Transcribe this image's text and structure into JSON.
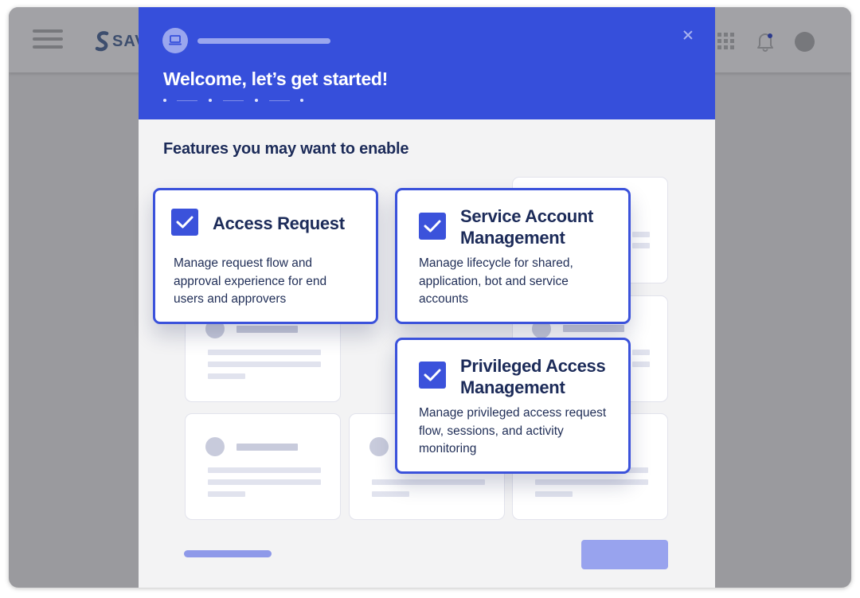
{
  "app": {
    "logo_text": "SAV"
  },
  "colors": {
    "accent": "#364fdb",
    "card_border": "#3b52db",
    "overlay": "#9a9a9e",
    "modal_bg": "#f3f3f4",
    "title_text": "#1c2b59"
  },
  "icons": {
    "menu": "hamburger-icon",
    "apps": "grid-icon",
    "notifications": "bell-icon",
    "profile": "avatar",
    "header": "laptop-icon",
    "close": "close-icon",
    "check": "check-icon"
  },
  "modal": {
    "title": "Welcome, let’s get started!",
    "steps_total": 4,
    "section_title": "Features you may want to enable",
    "features": [
      {
        "title": "Access Request",
        "description": "Manage request flow and approval experience for end users and approvers",
        "checked": true
      },
      {
        "title": "Service Account Management",
        "description": "Manage lifecycle for shared, application, bot and service accounts",
        "checked": true
      },
      {
        "title": "Privileged Access Management",
        "description": "Manage privileged access request flow, sessions, and activity monitoring",
        "checked": true
      }
    ]
  }
}
